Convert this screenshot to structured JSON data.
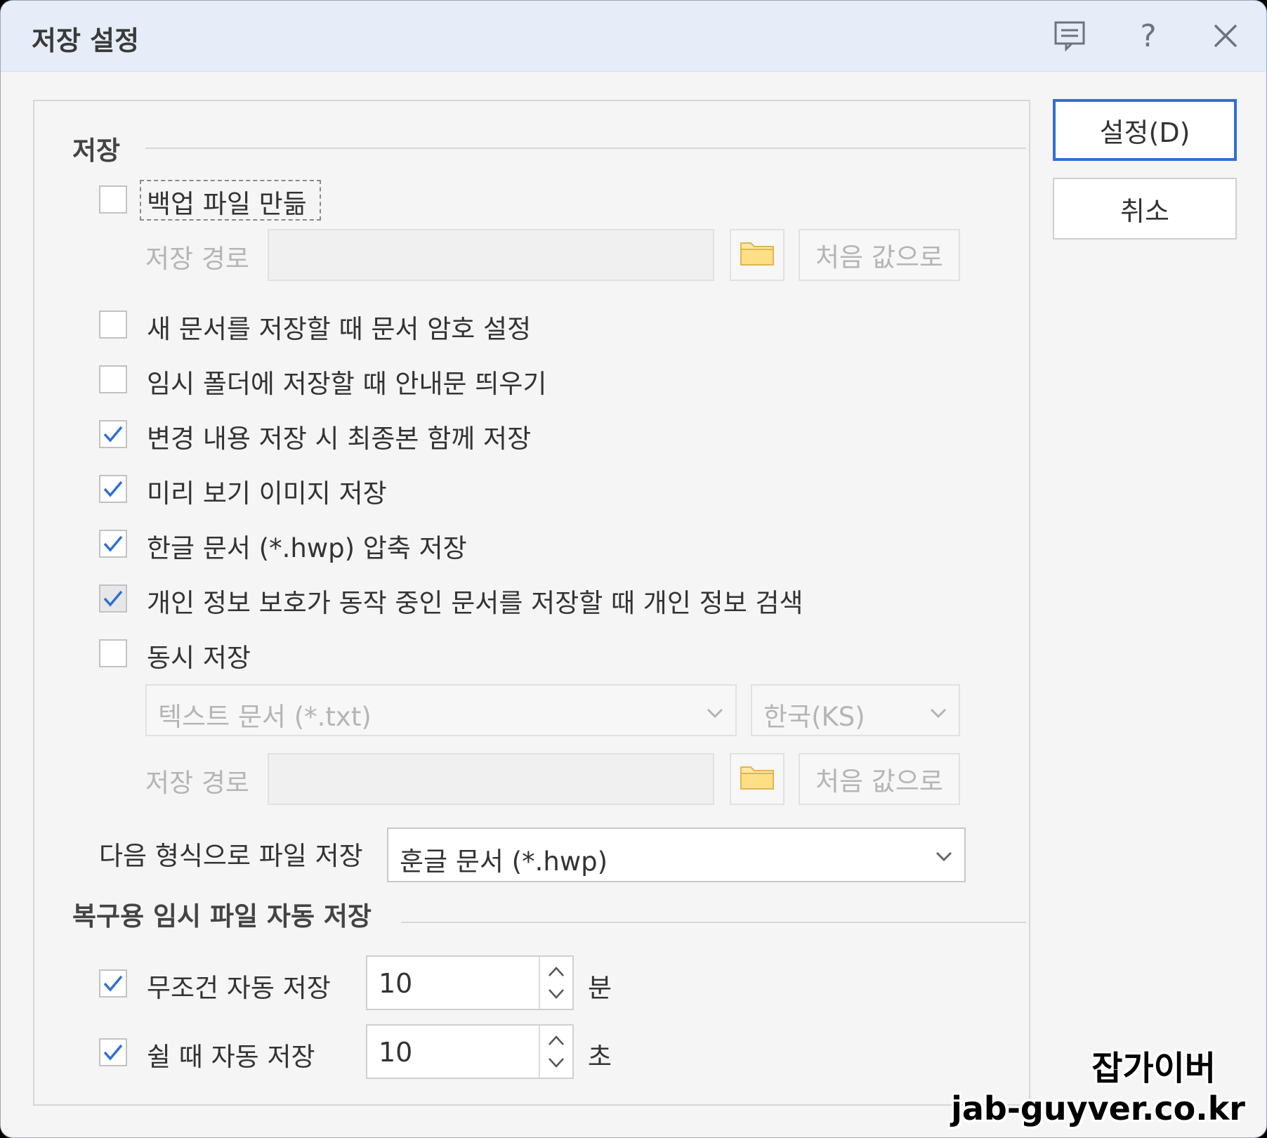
{
  "dialog": {
    "title": "저장 설정",
    "icons": [
      "comment-icon",
      "help-icon",
      "close-icon"
    ],
    "help_glyph": "?"
  },
  "buttons": {
    "ok": "설정(D)",
    "cancel": "취소"
  },
  "save_section": {
    "heading": "저장",
    "backup": {
      "label": "백업 파일 만듦",
      "checked": false
    },
    "backup_path": {
      "label": "저장 경로",
      "value": "",
      "reset_label": "처음 값으로"
    },
    "options": [
      {
        "label": "새 문서를 저장할 때 문서 암호 설정",
        "checked": false
      },
      {
        "label": "임시 폴더에 저장할 때 안내문 띄우기",
        "checked": false
      },
      {
        "label": "변경 내용 저장 시 최종본 함께 저장",
        "checked": true
      },
      {
        "label": "미리 보기 이미지 저장",
        "checked": true
      },
      {
        "label": "한글 문서 (*.hwp) 압축 저장",
        "checked": true
      },
      {
        "label": "개인 정보 보호가 동작 중인 문서를 저장할 때 개인 정보 검색",
        "checked": true,
        "disabled": true
      },
      {
        "label": "동시 저장",
        "checked": false
      }
    ],
    "simul_format": "텍스트 문서 (*.txt)",
    "simul_encoding": "한국(KS)",
    "simul_path": {
      "label": "저장 경로",
      "value": "",
      "reset_label": "처음 값으로"
    },
    "default_format_label": "다음 형식으로 파일 저장",
    "default_format_value": "훈글 문서 (*.hwp)"
  },
  "recovery_section": {
    "heading": "복구용 임시 파일 자동 저장",
    "always": {
      "label": "무조건 자동 저장",
      "checked": true,
      "value": "10",
      "unit": "분"
    },
    "idle": {
      "label": "쉴 때 자동 저장",
      "checked": true,
      "value": "10",
      "unit": "초"
    }
  },
  "watermark": {
    "name": "잡가이버",
    "url": "jab-guyver.co.kr"
  },
  "colors": {
    "accent": "#2f6fd6",
    "check": "#2f6fd6",
    "titlebar": "#e6edf8"
  }
}
